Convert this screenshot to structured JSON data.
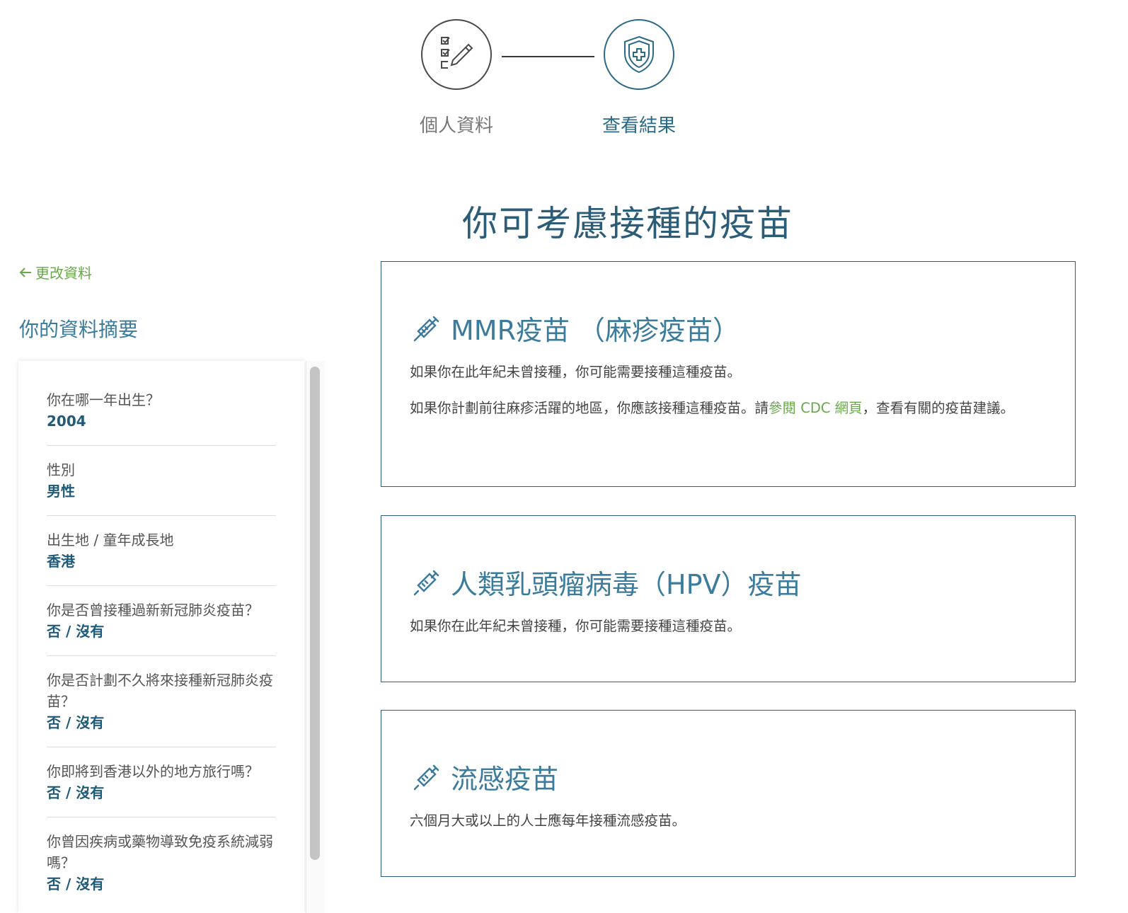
{
  "steps": [
    {
      "label": "個人資料",
      "icon": "checklist-pencil-icon"
    },
    {
      "label": "查看結果",
      "icon": "shield-plus-icon"
    }
  ],
  "page_title": "你可考慮接種的疫苗",
  "sidebar": {
    "back_label": "更改資料",
    "summary_title": "你的資料摘要",
    "items": [
      {
        "q": "你在哪一年出生？",
        "a": "2004"
      },
      {
        "q": "性別",
        "a": "男性"
      },
      {
        "q": "出生地 / 童年成長地",
        "a": "香港"
      },
      {
        "q": "你是否曾接種過新新冠肺炎疫苗？",
        "a": "否 / 沒有"
      },
      {
        "q": "你是否計劃不久將來接種新冠肺炎疫苗？",
        "a": "否 / 沒有"
      },
      {
        "q": "你即將到香港以外的地方旅行嗎？",
        "a": "否 / 沒有"
      },
      {
        "q": "你曾因疾病或藥物導致免疫系統減弱嗎？",
        "a": "否 / 沒有"
      }
    ]
  },
  "vaccines": [
    {
      "title": "MMR疫苗 （麻疹疫苗）",
      "p1": "如果你在此年紀未曾接種，你可能需要接種這種疫苗。",
      "p2_before": "如果你計劃前往麻疹活躍的地區，你應該接種這種疫苗。請",
      "p2_link": "參閱 CDC 網頁",
      "p2_after": "，查看有關的疫苗建議。"
    },
    {
      "title": "人類乳頭瘤病毒（HPV）疫苗",
      "p1": "如果你在此年紀未曾接種，你可能需要接種這種疫苗。"
    },
    {
      "title": "流感疫苗",
      "p1": "六個月大或以上的人士應每年接種流感疫苗。"
    }
  ],
  "colors": {
    "primary": "#2b5d78",
    "accent": "#3b7b9b",
    "link": "#6aa94a"
  }
}
